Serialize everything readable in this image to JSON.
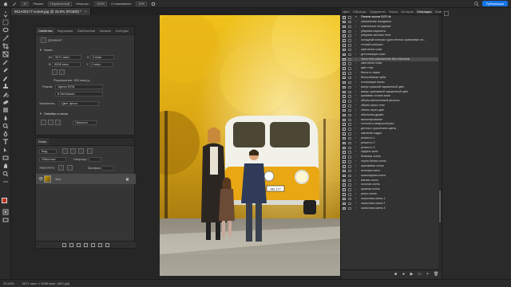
{
  "topbar": {
    "style_label": "Режим:",
    "style_value": "Нормальный",
    "opacity_label": "Непрозр.:",
    "opacity_value": "100%",
    "smoothing_label": "Сглаживание:",
    "smoothing_value": "10%",
    "publish_label": "Публикация"
  },
  "document": {
    "tab_title": "901A00177 копия.jpg @ 33,9% (RGB/8) *",
    "close_glyph": "×"
  },
  "properties": {
    "tabs": [
      "Свойства",
      "Коррекция",
      "Библиотеки",
      "Каналы",
      "Контуры"
    ],
    "doc_label": "Документ",
    "canvas_section": "Холст",
    "width_label": "Ш",
    "width_value": "3071 пикс.",
    "height_label": "В",
    "height_value": "5308 пикс.",
    "x_label": "X",
    "x_value": "0 пикс.",
    "y_label": "Y",
    "y_value": "0 пикс.",
    "resolution": "Разрешение: 300 пикс/д...",
    "mode_label": "Режим",
    "mode_value": "Цвета RGB",
    "bits_value": "8 бит/канал",
    "fill_label": "Заполнить",
    "fill_value": "Цвет фона",
    "rulers_section": "Линейки и сетки",
    "units_value": "Пиксели"
  },
  "layers": {
    "title": "Слои",
    "search_label": "Вид",
    "mode_value": "Обычные",
    "opacity_label": "Непрозр.:",
    "lock_label": "Закрепить:",
    "fill_label": "Заливка:",
    "layer_name": "Фон"
  },
  "right_panel": {
    "tabs": [
      "Цвет",
      "Образцы",
      "Градиенты",
      "Узоры",
      "История",
      "Операции",
      "Комментарии"
    ],
    "actions": [
      {
        "label": "Панель эшнов DCR.4k",
        "set": true
      },
      {
        "label": "затемнение исходника",
        "set": false
      },
      {
        "label": "осветление исходника",
        "set": false
      },
      {
        "label": "убираем паразиты",
        "set": false
      },
      {
        "label": "убираем жесткие тени",
        "set": false
      },
      {
        "label": "холодный контраст (для теплых оранжевых ли...",
        "set": false
      },
      {
        "label": "теплый контраст",
        "set": false
      },
      {
        "label": "смягчение кожи",
        "set": false
      },
      {
        "label": "детализация кожи",
        "set": false
      },
      {
        "label": "частотное разложение без плагинов",
        "set": false
      },
      {
        "label": "смягчение кожи",
        "set": false
      },
      {
        "label": "цвет глаз",
        "set": false
      },
      {
        "label": "блеск в глазах",
        "set": false
      },
      {
        "label": "белоснежная зубы",
        "set": false
      },
      {
        "label": "стилизация волос",
        "set": false
      },
      {
        "label": "минус красный паразитный цвет",
        "set": false
      },
      {
        "label": "минус оранжевый паразитный цвет",
        "set": false
      },
      {
        "label": "красивая сочная кожа",
        "set": false
      },
      {
        "label": "объем светотеневой рисунок",
        "set": false
      },
      {
        "label": "объем через тени",
        "set": false
      },
      {
        "label": "объем через цвет",
        "set": false
      },
      {
        "label": "объемная драма",
        "set": false
      },
      {
        "label": "виньетирование",
        "set": false
      },
      {
        "label": "теплота и микроконтраст",
        "set": false
      },
      {
        "label": "детали с усилением цвета",
        "set": false
      },
      {
        "label": "свечение кадра",
        "set": false
      },
      {
        "label": "резкость 1",
        "set": false
      },
      {
        "label": "резкость 2",
        "set": false
      },
      {
        "label": "резкость 3",
        "set": false
      },
      {
        "label": "эффект кино",
        "set": false
      },
      {
        "label": "бежевая осень",
        "set": false
      },
      {
        "label": "черно-белая осень",
        "set": false
      },
      {
        "label": "оранжевая осень",
        "set": false
      },
      {
        "label": "зеленая осень",
        "set": false
      },
      {
        "label": "шоколадная осень",
        "set": false
      },
      {
        "label": "мягкая осень",
        "set": false
      },
      {
        "label": "золотая осень",
        "set": false
      },
      {
        "label": "красная осень",
        "set": false
      },
      {
        "label": "ретро осень",
        "set": false
      },
      {
        "label": "сказочная осень 1",
        "set": false
      },
      {
        "label": "сказочная осень 2",
        "set": false
      },
      {
        "label": "сказочная осень 3",
        "set": false
      }
    ],
    "highlighted_index": 9
  },
  "status": {
    "zoom": "33,94%",
    "size": "3071 пикс. x 5308 пикс. (300 ppi)"
  },
  "colors": {
    "foreground": "#c0301c",
    "background": "#f2f2f2",
    "accent": "#1473e6"
  },
  "photo": {
    "plate_text": "НВ 177"
  }
}
